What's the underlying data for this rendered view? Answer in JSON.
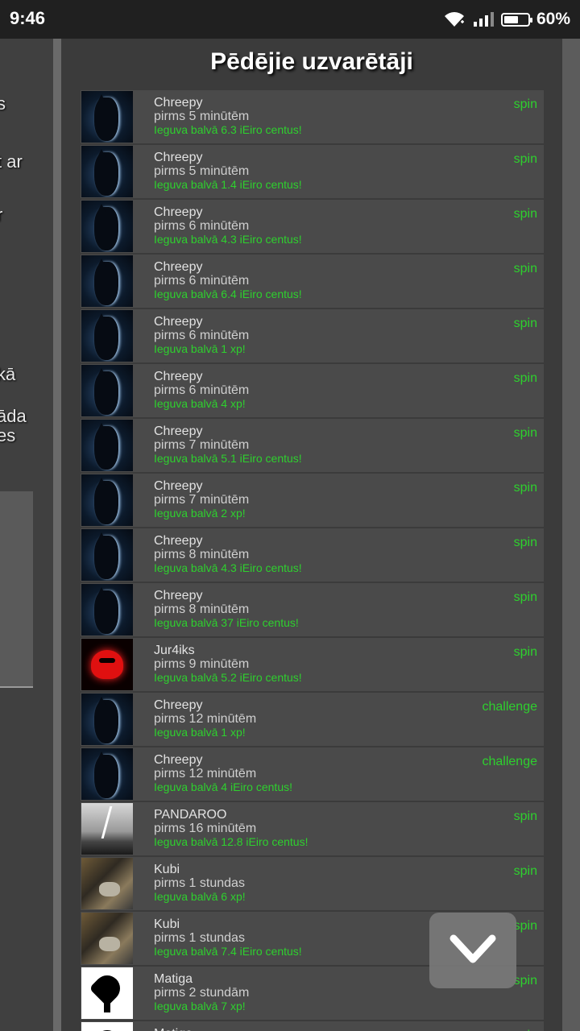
{
  "status_bar": {
    "time": "9:46",
    "battery_percent": "60%",
    "battery_level": 0.6
  },
  "background_fragments": [
    "s",
    "t ar",
    "r",
    "kā",
    "āda",
    "es"
  ],
  "title": "Pēdējie uzvarētāji",
  "winners": [
    {
      "avatar": "cat-silhouette",
      "name": "Chreepy",
      "ago": "pirms 5 minūtēm",
      "prize": "Ieguva balvā 6.3 iEiro centus!",
      "game": "spin"
    },
    {
      "avatar": "cat-silhouette",
      "name": "Chreepy",
      "ago": "pirms 5 minūtēm",
      "prize": "Ieguva balvā 1.4 iEiro centus!",
      "game": "spin"
    },
    {
      "avatar": "cat-silhouette",
      "name": "Chreepy",
      "ago": "pirms 6 minūtēm",
      "prize": "Ieguva balvā 4.3 iEiro centus!",
      "game": "spin"
    },
    {
      "avatar": "cat-silhouette",
      "name": "Chreepy",
      "ago": "pirms 6 minūtēm",
      "prize": "Ieguva balvā 6.4 iEiro centus!",
      "game": "spin"
    },
    {
      "avatar": "cat-silhouette",
      "name": "Chreepy",
      "ago": "pirms 6 minūtēm",
      "prize": "Ieguva balvā 1 xp!",
      "game": "spin"
    },
    {
      "avatar": "cat-silhouette",
      "name": "Chreepy",
      "ago": "pirms 6 minūtēm",
      "prize": "Ieguva balvā 4 xp!",
      "game": "spin"
    },
    {
      "avatar": "cat-silhouette",
      "name": "Chreepy",
      "ago": "pirms 7 minūtēm",
      "prize": "Ieguva balvā 5.1 iEiro centus!",
      "game": "spin"
    },
    {
      "avatar": "cat-silhouette",
      "name": "Chreepy",
      "ago": "pirms 7 minūtēm",
      "prize": "Ieguva balvā 2 xp!",
      "game": "spin"
    },
    {
      "avatar": "cat-silhouette",
      "name": "Chreepy",
      "ago": "pirms 8 minūtēm",
      "prize": "Ieguva balvā 4.3 iEiro centus!",
      "game": "spin"
    },
    {
      "avatar": "cat-silhouette",
      "name": "Chreepy",
      "ago": "pirms 8 minūtēm",
      "prize": "Ieguva balvā 37 iEiro centus!",
      "game": "spin"
    },
    {
      "avatar": "red-devil",
      "name": "Jur4iks",
      "ago": "pirms 9 minūtēm",
      "prize": "Ieguva balvā 5.2 iEiro centus!",
      "game": "spin"
    },
    {
      "avatar": "cat-silhouette",
      "name": "Chreepy",
      "ago": "pirms 12 minūtēm",
      "prize": "Ieguva balvā 1 xp!",
      "game": "challenge"
    },
    {
      "avatar": "cat-silhouette",
      "name": "Chreepy",
      "ago": "pirms 12 minūtēm",
      "prize": "Ieguva balvā 4 iEiro centus!",
      "game": "challenge"
    },
    {
      "avatar": "storm-road",
      "name": "PANDAROO",
      "ago": "pirms 16 minūtēm",
      "prize": "Ieguva balvā 12.8 iEiro centus!",
      "game": "spin"
    },
    {
      "avatar": "outdoor-photo",
      "name": "Kubi",
      "ago": "pirms 1 stundas",
      "prize": "Ieguva balvā 6 xp!",
      "game": "spin"
    },
    {
      "avatar": "outdoor-photo",
      "name": "Kubi",
      "ago": "pirms 1 stundas",
      "prize": "Ieguva balvā 7.4 iEiro centus!",
      "game": "spin"
    },
    {
      "avatar": "ace-of-spades",
      "name": "Matiga",
      "ago": "pirms 2 stundām",
      "prize": "Ieguva balvā 7 xp!",
      "game": "spin"
    },
    {
      "avatar": "ace-of-spades",
      "name": "Matiga",
      "ago": "",
      "prize": "",
      "game": "spin"
    }
  ],
  "scroll_button_icon": "chevron-down-icon",
  "colors": {
    "accent_green": "#2ed02e",
    "row_bg": "#4a4a4a",
    "panel_bg": "#3b3b3b"
  }
}
